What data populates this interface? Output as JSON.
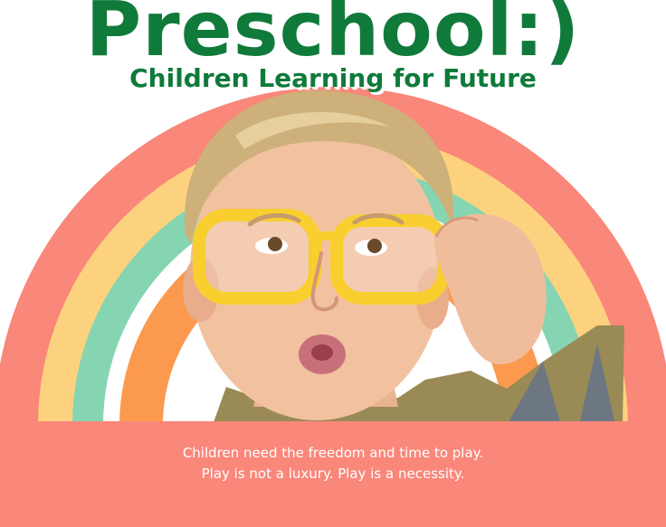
{
  "header": {
    "title": "Preschool:)",
    "subtitle": "Children Learning for Future"
  },
  "quote": {
    "line1": "Children need the freedom and time to play.",
    "line2": "Play is not a luxury. Play is a necessity."
  },
  "colors": {
    "title_green": "#0f7a3a",
    "rainbow_outer": "#f9877a",
    "rainbow_yellow": "#fdd27e",
    "rainbow_green": "#86d5b2",
    "rainbow_orange": "#fb9a4f",
    "footer_band": "#f9877a",
    "glasses_yellow": "#f8cf2e"
  },
  "image": {
    "subject": "boy-with-yellow-glasses-photo"
  }
}
